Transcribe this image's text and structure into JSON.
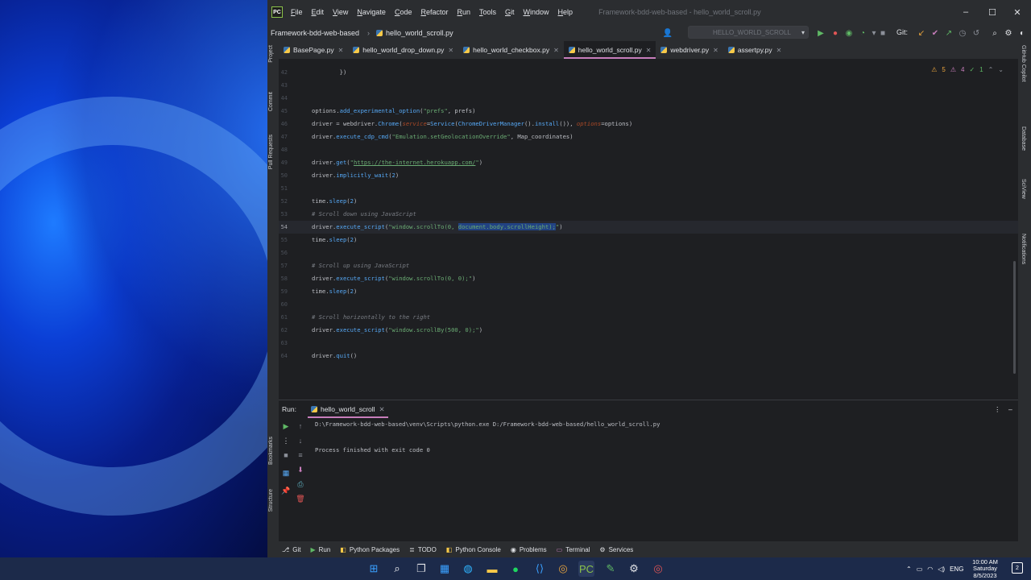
{
  "titlebar": {
    "menu": [
      "File",
      "Edit",
      "View",
      "Navigate",
      "Code",
      "Refactor",
      "Run",
      "Tools",
      "Git",
      "Window",
      "Help"
    ],
    "window_title": "Framework-bdd-web-based - hello_world_scroll.py"
  },
  "navbar": {
    "project": "Framework-bdd-web-based",
    "file": "hello_world_scroll.py",
    "run_config": "HELLO_WORLD_SCROLL",
    "git_label": "Git:"
  },
  "left_strip": {
    "project": "Project",
    "commit": "Commit",
    "pull_requests": "Pull Requests",
    "bookmarks": "Bookmarks",
    "structure": "Structure"
  },
  "right_strip": {
    "copilot": "GitHub Copilot",
    "database": "Database",
    "sciview": "SciView",
    "notifications": "Notifications"
  },
  "tabs": [
    {
      "label": "BasePage.py",
      "active": false
    },
    {
      "label": "hello_world_drop_down.py",
      "active": false
    },
    {
      "label": "hello_world_checkbox.py",
      "active": false
    },
    {
      "label": "hello_world_scroll.py",
      "active": true
    },
    {
      "label": "webdriver.py",
      "active": false
    },
    {
      "label": "assertpy.py",
      "active": false
    }
  ],
  "inspections": {
    "warnings": "5",
    "weak_warnings": "4",
    "typos": "1"
  },
  "editor": {
    "current_line": "54",
    "lines": [
      {
        "n": "42",
        "text": "        })"
      },
      {
        "n": "43",
        "text": ""
      },
      {
        "n": "44",
        "text": ""
      },
      {
        "n": "45",
        "text": "options.add_experimental_option(\"prefs\", prefs)"
      },
      {
        "n": "46",
        "text": "driver = webdriver.Chrome(service=Service(ChromeDriverManager().install()), options=options)"
      },
      {
        "n": "47",
        "text": "driver.execute_cdp_cmd(\"Emulation.setGeolocationOverride\", Map_coordinates)"
      },
      {
        "n": "48",
        "text": ""
      },
      {
        "n": "49",
        "text": "driver.get(\"https://the-internet.herokuapp.com/\")"
      },
      {
        "n": "50",
        "text": "driver.implicitly_wait(2)"
      },
      {
        "n": "51",
        "text": ""
      },
      {
        "n": "52",
        "text": "time.sleep(2)"
      },
      {
        "n": "53",
        "text": "# Scroll down using JavaScript"
      },
      {
        "n": "54",
        "text": "driver.execute_script(\"window.scrollTo(0, document.body.scrollHeight);\")"
      },
      {
        "n": "55",
        "text": "time.sleep(2)"
      },
      {
        "n": "56",
        "text": ""
      },
      {
        "n": "57",
        "text": "# Scroll up using JavaScript"
      },
      {
        "n": "58",
        "text": "driver.execute_script(\"window.scrollTo(0, 0);\")"
      },
      {
        "n": "59",
        "text": "time.sleep(2)"
      },
      {
        "n": "60",
        "text": ""
      },
      {
        "n": "61",
        "text": "# Scroll horizontally to the right"
      },
      {
        "n": "62",
        "text": "driver.execute_script(\"window.scrollBy(500, 0);\")"
      },
      {
        "n": "63",
        "text": ""
      },
      {
        "n": "64",
        "text": "driver.quit()"
      }
    ]
  },
  "run_panel": {
    "label": "Run:",
    "tab": "hello_world_scroll",
    "command": "D:\\Framework-bdd-web-based\\venv\\Scripts\\python.exe D:/Framework-bdd-web-based/hello_world_scroll.py",
    "exit_message": "Process finished with exit code 0"
  },
  "bottom_tools": [
    "Git",
    "Run",
    "Python Packages",
    "TODO",
    "Python Console",
    "Problems",
    "Terminal",
    "Services"
  ],
  "taskbar": {
    "language": "ENG",
    "time": "10:00 AM",
    "day": "Saturday",
    "date": "8/5/2023",
    "notification_count": "2"
  },
  "colors": {
    "accent_tab": "#c77dbb",
    "editor_bg": "#1e1f22",
    "panel_bg": "#2b2d30",
    "string": "#6aab73",
    "function": "#56a8f5",
    "comment": "#7a7e85"
  }
}
